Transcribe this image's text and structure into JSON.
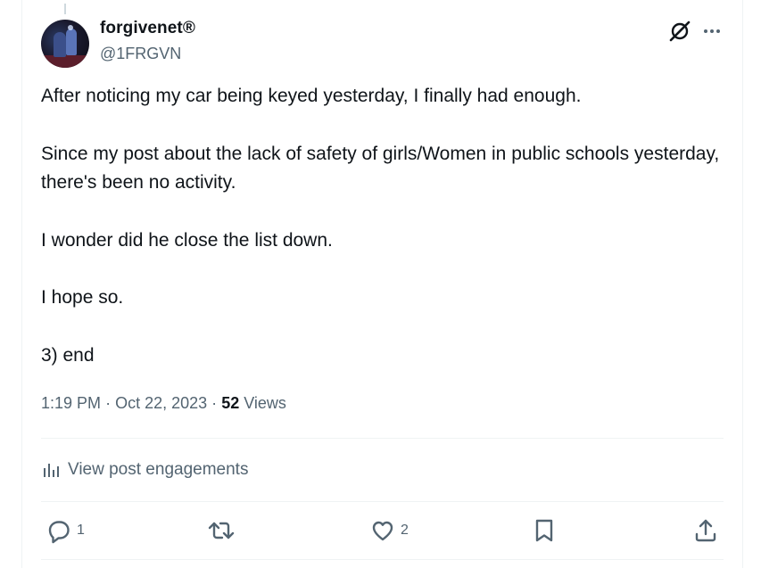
{
  "author": {
    "display_name": "forgivenet®",
    "handle": "@1FRGVN"
  },
  "icons": {
    "grok": "grok-icon",
    "more": "more-icon",
    "analytics": "bar-chart-icon",
    "reply": "reply-icon",
    "repost": "repost-icon",
    "like": "heart-icon",
    "bookmark": "bookmark-icon",
    "share": "share-icon"
  },
  "post": {
    "paragraphs": [
      "After noticing my car being keyed yesterday, I finally had enough.",
      "Since my post about the lack of safety of girls/Women in public schools yesterday, there's been no activity.",
      "I wonder did he close the list down.",
      "I hope so.",
      "3) end"
    ],
    "time": "1:19 PM",
    "date": "Oct 22, 2023",
    "separator": "·",
    "views_count": "52",
    "views_label": "Views"
  },
  "engagements_label": "View post engagements",
  "actions": {
    "reply_count": "1",
    "repost_count": "",
    "like_count": "2"
  },
  "colors": {
    "text": "#0f1419",
    "secondary": "#536471",
    "border": "#eff3f4"
  }
}
